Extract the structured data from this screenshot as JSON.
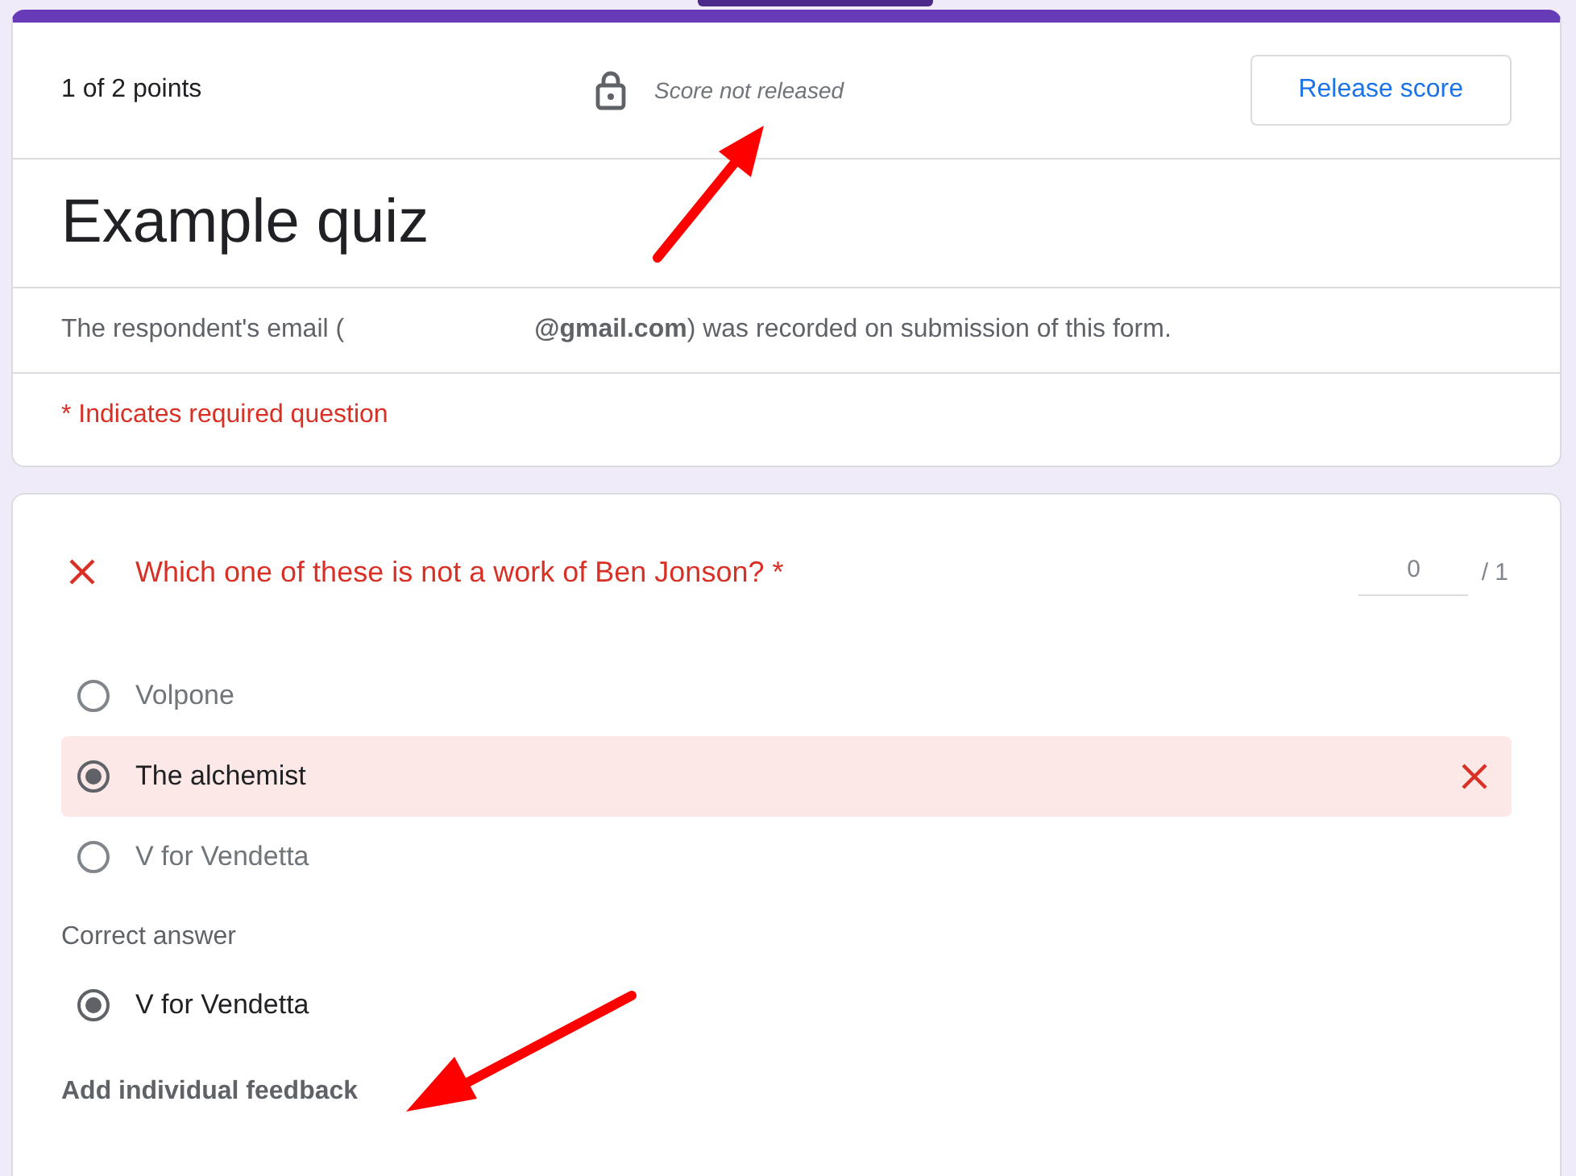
{
  "header": {
    "points": "1 of 2 points",
    "score_status": "Score not released",
    "release_button": "Release score"
  },
  "form": {
    "title": "Example quiz",
    "email_prefix": "The respondent's email (",
    "email_suffix": "**@gmail.com**) was recorded on submission of this form.",
    "required_note": "* Indicates required question"
  },
  "question": {
    "text": "Which one of these is not a work of Ben Jonson? *",
    "incorrect": true,
    "score": "0",
    "max_score": "/ 1",
    "options": [
      {
        "label": "Volpone",
        "selected": false,
        "incorrect": false
      },
      {
        "label": "The alchemist",
        "selected": true,
        "incorrect": true
      },
      {
        "label": "V for Vendetta",
        "selected": false,
        "incorrect": false
      }
    ],
    "correct_label": "Correct answer",
    "correct_options": [
      {
        "label": "V for Vendetta",
        "selected": true
      }
    ],
    "feedback_link": "Add individual feedback"
  }
}
